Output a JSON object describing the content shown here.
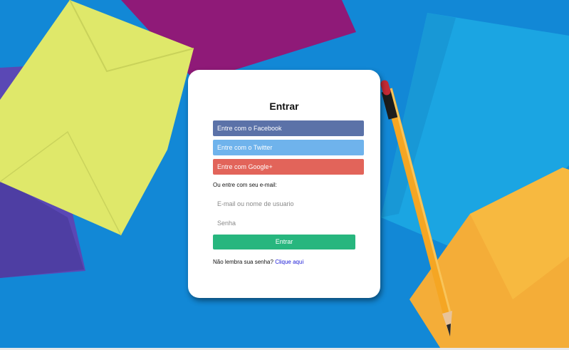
{
  "login": {
    "title": "Entrar",
    "facebook_label": "Entre com o Facebook",
    "twitter_label": "Entre com o Twitter",
    "google_label": "Entre com Google+",
    "or_email_label": "Ou entre com seu e-mail:",
    "username_placeholder": "E-mail ou nome de usuario",
    "password_placeholder": "Senha",
    "submit_label": "Entrar",
    "forgot_text": "Não lembra sua senha?",
    "forgot_link": "Clique aqui"
  },
  "colors": {
    "facebook": "#5b72a8",
    "twitter": "#6fb3ec",
    "google": "#e2645a",
    "submit": "#27b67e",
    "link": "#1a1ad6",
    "background": "#1288d6"
  }
}
